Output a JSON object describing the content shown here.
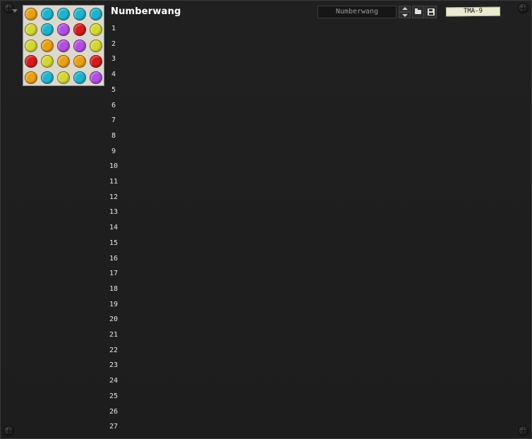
{
  "module": {
    "title": "Numberwang",
    "preset_name": "Numberwang",
    "brand_label": "TMA-9"
  },
  "rows": [
    "1",
    "2",
    "3",
    "4",
    "5",
    "6",
    "7",
    "8",
    "9",
    "10",
    "11",
    "12",
    "13",
    "14",
    "15",
    "16",
    "17",
    "18",
    "19",
    "20",
    "21",
    "22",
    "23",
    "24",
    "25",
    "26",
    "27"
  ],
  "thumbnail": {
    "background": "#ddd8cc",
    "palette": {
      "orange": "#e8a014",
      "cyan": "#1fb2cc",
      "yellow": "#d4d636",
      "purple": "#b24ee0",
      "red": "#d41a1a"
    },
    "grid": [
      [
        "orange",
        "cyan",
        "cyan",
        "cyan",
        "cyan"
      ],
      [
        "yellow",
        "cyan",
        "purple",
        "red",
        "yellow"
      ],
      [
        "yellow",
        "orange",
        "purple",
        "purple",
        "yellow"
      ],
      [
        "red",
        "yellow",
        "orange",
        "orange",
        "red"
      ],
      [
        "orange",
        "cyan",
        "yellow",
        "cyan",
        "purple"
      ]
    ]
  },
  "icons": {
    "collapse": "triangle-down",
    "spin_up": "arrow-up",
    "spin_down": "arrow-down",
    "open": "folder",
    "save": "floppy-disk",
    "screws": "screw"
  }
}
